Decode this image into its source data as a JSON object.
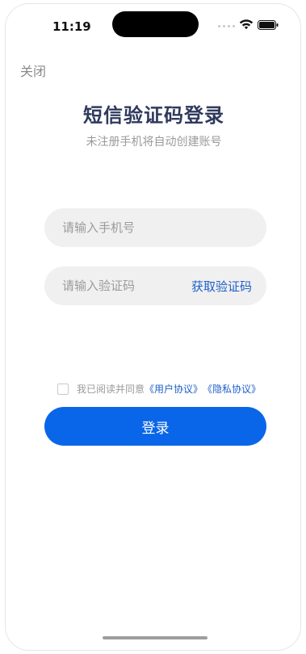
{
  "status_bar": {
    "time": "11:19",
    "icons": [
      "cellular-dots-icon",
      "wifi-icon",
      "battery-icon"
    ]
  },
  "header": {
    "close_label": "关闭",
    "title": "短信验证码登录",
    "subtitle": "未注册手机将自动创建账号"
  },
  "form": {
    "phone_placeholder": "请输入手机号",
    "phone_value": "",
    "code_placeholder": "请输入验证码",
    "code_value": "",
    "get_code_label": "获取验证码"
  },
  "agreement": {
    "checked": false,
    "prefix": "我已阅读并同意",
    "user_agreement": "《用户协议》",
    "privacy_policy": "《隐私协议》"
  },
  "login_label": "登录",
  "colors": {
    "primary": "#0a66e8",
    "link": "#1f5fc9",
    "title": "#2f3a5c",
    "field_bg": "#f0f0f0"
  }
}
